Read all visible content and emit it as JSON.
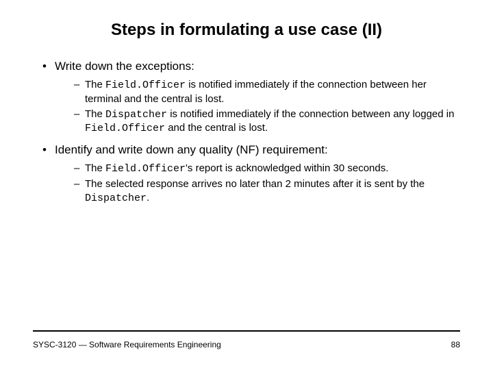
{
  "title": "Steps in formulating a use case (II)",
  "b1": "Write down the exceptions:",
  "b1s1a": "The ",
  "b1s1m": "Field.Officer",
  "b1s1b": " is notified immediately if the connection between her terminal and the central is lost.",
  "b1s2a": "The ",
  "b1s2m1": "Dispatcher",
  "b1s2b": " is notified immediately if the connection between any logged in ",
  "b1s2m2": "Field.Officer",
  "b1s2c": " and the central is lost.",
  "b2": "Identify and write down any quality (NF) requirement:",
  "b2s1a": "The ",
  "b2s1m": "Field.Officer",
  "b2s1b": "'s report is acknowledged within 30 seconds.",
  "b2s2a": "The selected response arrives no later than 2 minutes after it is sent by the ",
  "b2s2m": "Dispatcher",
  "b2s2b": ".",
  "footer": "SYSC-3120 — Software Requirements Engineering",
  "page": "88"
}
